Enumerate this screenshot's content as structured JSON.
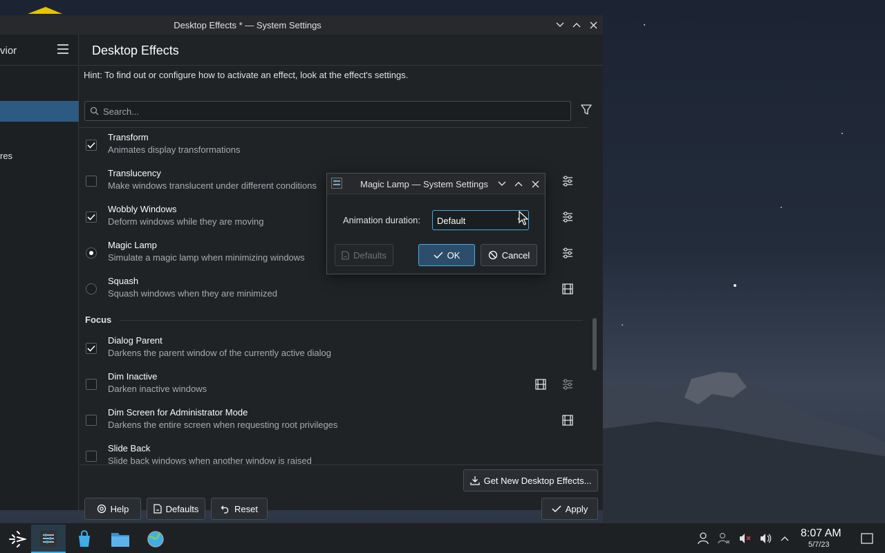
{
  "window": {
    "title": "Desktop Effects * — System Settings"
  },
  "sidebar": {
    "header_label": "vior",
    "partial_item": "res"
  },
  "page": {
    "title": "Desktop Effects",
    "hint": "Hint: To find out or configure how to activate an effect, look at the effect's settings.",
    "search_placeholder": "Search..."
  },
  "effects": [
    {
      "name": "Transform",
      "desc": "Animates display transformations",
      "control": "checkbox",
      "checked": true
    },
    {
      "name": "Translucency",
      "desc": "Make windows translucent under different conditions",
      "control": "checkbox",
      "checked": false,
      "icons": [
        "configure-icon"
      ]
    },
    {
      "name": "Wobbly Windows",
      "desc": "Deform windows while they are moving",
      "control": "checkbox",
      "checked": true,
      "icons": [
        "configure-icon"
      ]
    },
    {
      "name": "Magic Lamp",
      "desc": "Simulate a magic lamp when minimizing windows",
      "control": "radio",
      "checked": true,
      "icons": [
        "configure-icon"
      ]
    },
    {
      "name": "Squash",
      "desc": "Squash windows when they are minimized",
      "control": "radio",
      "checked": false,
      "icons": [
        "video-icon"
      ]
    }
  ],
  "focus_section": {
    "label": "Focus",
    "effects": [
      {
        "name": "Dialog Parent",
        "desc": "Darkens the parent window of the currently active dialog",
        "control": "checkbox",
        "checked": true
      },
      {
        "name": "Dim Inactive",
        "desc": "Darken inactive windows",
        "control": "checkbox",
        "checked": false,
        "icons": [
          "video-icon",
          "configure-icon"
        ]
      },
      {
        "name": "Dim Screen for Administrator Mode",
        "desc": "Darkens the entire screen when requesting root privileges",
        "control": "checkbox",
        "checked": false,
        "icons": [
          "video-icon"
        ]
      },
      {
        "name": "Slide Back",
        "desc": "Slide back windows when another window is raised",
        "control": "checkbox",
        "checked": false
      }
    ]
  },
  "footer": {
    "get_new": "Get New Desktop Effects...",
    "help": "Help",
    "defaults": "Defaults",
    "reset": "Reset",
    "apply": "Apply"
  },
  "dialog": {
    "title": "Magic Lamp — System Settings",
    "field_label": "Animation duration:",
    "field_value": "Default",
    "defaults": "Defaults",
    "ok": "OK",
    "cancel": "Cancel"
  },
  "taskbar": {
    "time": "8:07 AM",
    "date": "5/7/23"
  },
  "colors": {
    "accent": "#3daee9",
    "selection": "#2d5a80",
    "window_bg": "#202326"
  }
}
